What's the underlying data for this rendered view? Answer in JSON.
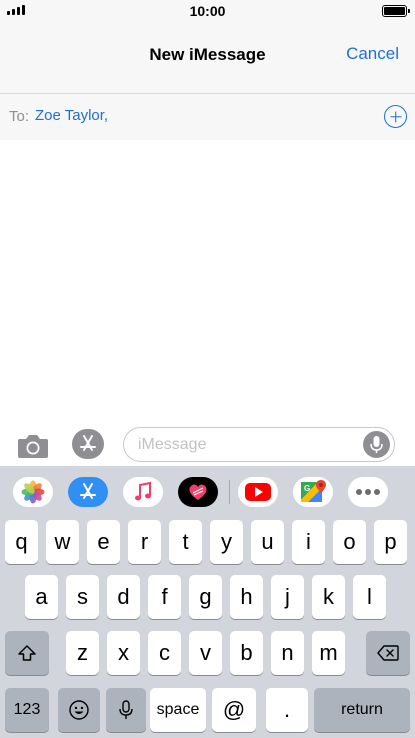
{
  "status_bar": {
    "time": "10:00"
  },
  "nav": {
    "title": "New iMessage",
    "cancel_label": "Cancel"
  },
  "recipients": {
    "label": "To:",
    "name": "Zoe Taylor,"
  },
  "compose": {
    "placeholder": "iMessage"
  },
  "app_strip": [
    {
      "name": "photos-app-icon"
    },
    {
      "name": "app-store-icon"
    },
    {
      "name": "music-app-icon"
    },
    {
      "name": "digital-touch-icon"
    },
    {
      "name": "youtube-app-icon"
    },
    {
      "name": "google-maps-app-icon"
    },
    {
      "name": "more-apps-icon"
    }
  ],
  "keyboard": {
    "row1": [
      "q",
      "w",
      "e",
      "r",
      "t",
      "y",
      "u",
      "i",
      "o",
      "p"
    ],
    "row2": [
      "a",
      "s",
      "d",
      "f",
      "g",
      "h",
      "j",
      "k",
      "l"
    ],
    "row3": [
      "z",
      "x",
      "c",
      "v",
      "b",
      "n",
      "m"
    ],
    "numbers_label": "123",
    "space_label": "space",
    "at_label": "@",
    "period_label": ".",
    "return_label": "return"
  },
  "colors": {
    "accent": "#1e6fd9",
    "keyboard_bg": "#d2d5db",
    "key_dark": "#acb3bd"
  }
}
